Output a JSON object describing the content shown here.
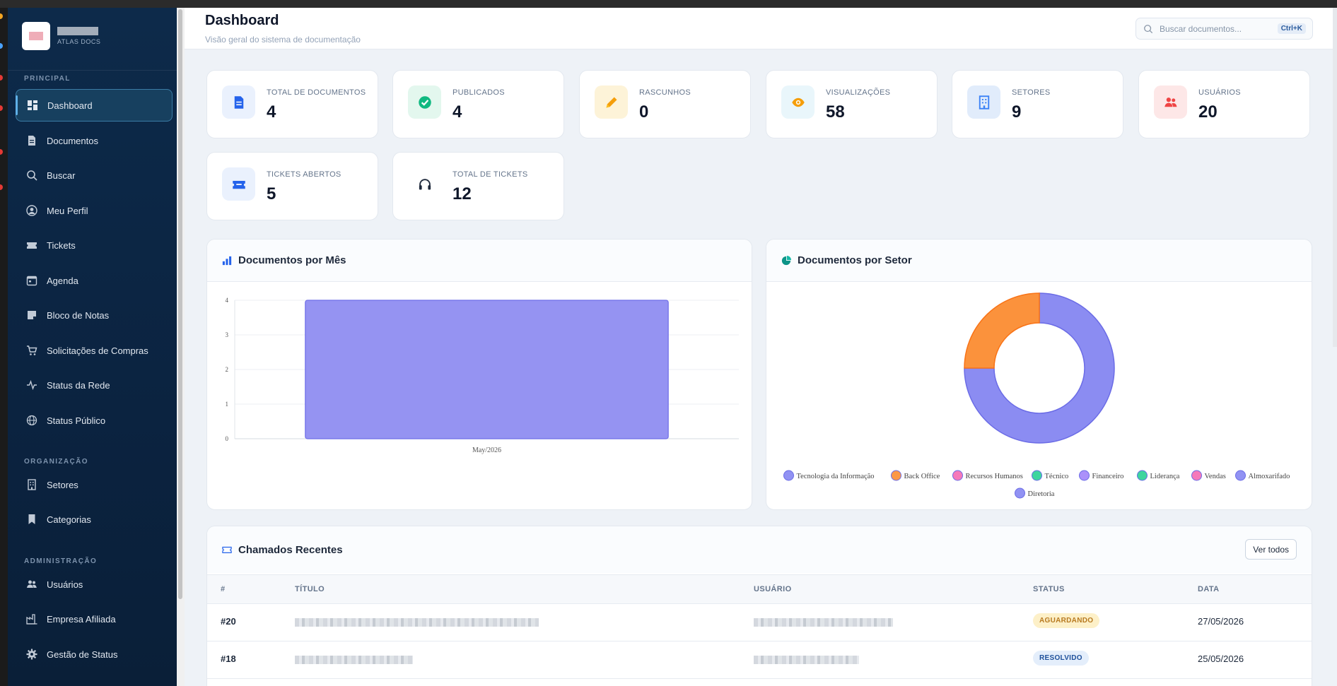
{
  "brand": {
    "subtitle": "ATLAS DOCS"
  },
  "sidebar": {
    "sections": [
      {
        "label": "PRINCIPAL"
      },
      {
        "label": "ORGANIZAÇÃO"
      },
      {
        "label": "ADMINISTRAÇÃO"
      }
    ],
    "items": [
      {
        "label": "Dashboard",
        "icon": "dashboard-icon",
        "active": true
      },
      {
        "label": "Documentos",
        "icon": "document-icon"
      },
      {
        "label": "Buscar",
        "icon": "search-icon"
      },
      {
        "label": "Meu Perfil",
        "icon": "user-circle-icon"
      },
      {
        "label": "Tickets",
        "icon": "ticket-icon"
      },
      {
        "label": "Agenda",
        "icon": "calendar-icon"
      },
      {
        "label": "Bloco de Notas",
        "icon": "note-icon"
      },
      {
        "label": "Solicitações de Compras",
        "icon": "cart-icon"
      },
      {
        "label": "Status da Rede",
        "icon": "pulse-icon"
      },
      {
        "label": "Status Público",
        "icon": "globe-icon"
      },
      {
        "label": "Setores",
        "icon": "building-icon"
      },
      {
        "label": "Categorias",
        "icon": "bookmark-icon"
      },
      {
        "label": "Usuários",
        "icon": "users-icon"
      },
      {
        "label": "Empresa Afiliada",
        "icon": "factory-icon"
      },
      {
        "label": "Gestão de Status",
        "icon": "gear-icon"
      }
    ]
  },
  "header": {
    "title": "Dashboard",
    "subtitle": "Visão geral do sistema de documentação",
    "search_placeholder": "Buscar documentos...",
    "search_shortcut": "Ctrl+K"
  },
  "stats": [
    {
      "label": "TOTAL DE DOCUMENTOS",
      "value": "4",
      "icon": "document-icon",
      "color": "#2563eb",
      "bg": "#eaf1fd"
    },
    {
      "label": "PUBLICADOS",
      "value": "4",
      "icon": "check-circle-icon",
      "color": "#10b981",
      "bg": "#e3f7ee"
    },
    {
      "label": "RASCUNHOS",
      "value": "0",
      "icon": "pencil-icon",
      "color": "#f59e0b",
      "bg": "#fdf3d8"
    },
    {
      "label": "VISUALIZAÇÕES",
      "value": "58",
      "icon": "eye-icon",
      "color": "#f59e0b",
      "bg": "#e9f6fb"
    },
    {
      "label": "SETORES",
      "value": "9",
      "icon": "building-icon",
      "color": "#3b82f6",
      "bg": "#e1ecfb"
    },
    {
      "label": "USUÁRIOS",
      "value": "20",
      "icon": "users-icon",
      "color": "#ef4444",
      "bg": "#fde7e7"
    },
    {
      "label": "TICKETS ABERTOS",
      "value": "5",
      "icon": "ticket-icon",
      "color": "#2563eb",
      "bg": "#eaf1fd"
    },
    {
      "label": "TOTAL DE TICKETS",
      "value": "12",
      "icon": "headset-icon",
      "color": "#1e293b",
      "bg": "#ffffff"
    }
  ],
  "panels": {
    "bar_title": "Documentos por Mês",
    "pie_title": "Documentos por Setor"
  },
  "chart_data": [
    {
      "type": "bar",
      "title": "Documentos por Mês",
      "categories": [
        "May/2026"
      ],
      "values": [
        4
      ],
      "ylim": [
        0,
        4
      ],
      "yticks": [
        0,
        1,
        2,
        3,
        4
      ],
      "grid": true,
      "color": "#9593f2"
    },
    {
      "type": "pie",
      "title": "Documentos por Setor",
      "donut": true,
      "legend_position": "bottom",
      "categories": [
        "Tecnologia da Informação",
        "Back Office",
        "Recursos Humanos",
        "Técnico",
        "Financeiro",
        "Liderança",
        "Vendas",
        "Almoxarifado",
        "Diretoria"
      ],
      "values": [
        3,
        1,
        0,
        0,
        0,
        0,
        0,
        0,
        0
      ],
      "colors": [
        "#8b8cf2",
        "#fb923c",
        "#f472b6",
        "#34d399",
        "#a78bfa",
        "#34d399",
        "#f472b6",
        "#8b8cf2",
        "#8b8cf2"
      ]
    }
  ],
  "tickets": {
    "title": "Chamados Recentes",
    "view_all": "Ver todos",
    "columns": [
      "#",
      "TÍTULO",
      "USUÁRIO",
      "STATUS",
      "DATA"
    ],
    "rows": [
      {
        "id": "#20",
        "status": "AGUARDANDO",
        "status_kind": "wait",
        "date": "27/05/2026",
        "title_w": 345,
        "user_w": 197
      },
      {
        "id": "#18",
        "status": "RESOLVIDO",
        "status_kind": "done",
        "date": "25/05/2026",
        "title_w": 167,
        "user_w": 149
      }
    ]
  }
}
